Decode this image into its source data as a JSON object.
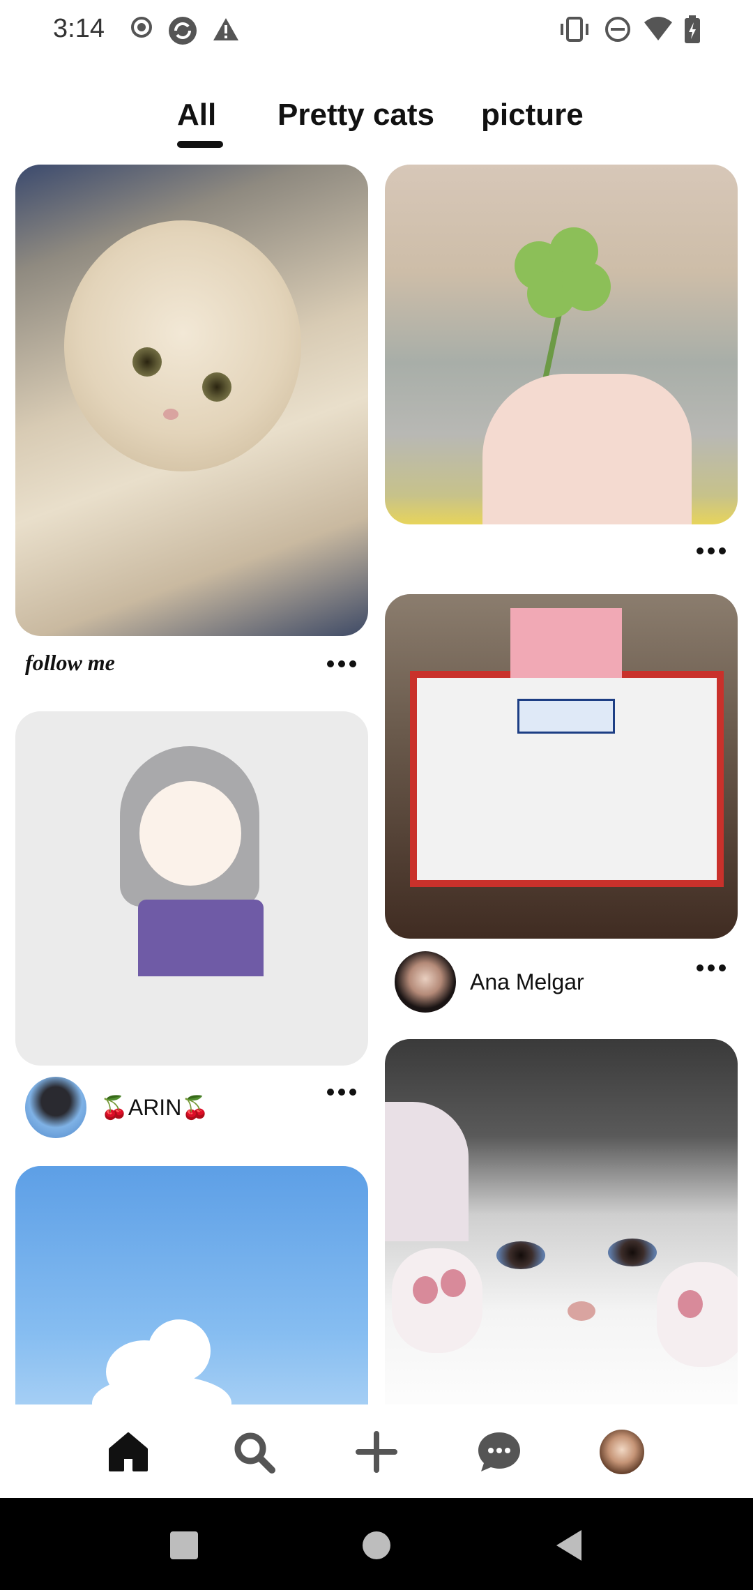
{
  "status_bar": {
    "time": "3:14",
    "left_icons": [
      "record-icon",
      "sync-icon",
      "warning-icon"
    ],
    "right_icons": [
      "vibrate-icon",
      "do-not-disturb-icon",
      "wifi-icon",
      "battery-icon"
    ]
  },
  "tabs": [
    {
      "label": "All",
      "selected": true
    },
    {
      "label": "Pretty cats",
      "selected": false
    },
    {
      "label": "picture",
      "selected": false
    }
  ],
  "feed": {
    "left": [
      {
        "image": "fluffy-cream-kitten",
        "caption": "follow me"
      },
      {
        "image": "chibi-girl-drawing",
        "author": "🍒ARIN🍒"
      },
      {
        "image": "blue-sky-cloud"
      }
    ],
    "right": [
      {
        "image": "hand-holding-clover"
      },
      {
        "image": "walt-disney-poster-board",
        "author": "Ana Melgar"
      },
      {
        "image": "white-cat-paws"
      }
    ]
  },
  "bottom_nav": [
    "home-icon",
    "search-icon",
    "create-icon",
    "messages-icon",
    "profile-avatar"
  ],
  "colors": {
    "text": "#111111",
    "background": "#ffffff",
    "system_nav": "#000000"
  }
}
